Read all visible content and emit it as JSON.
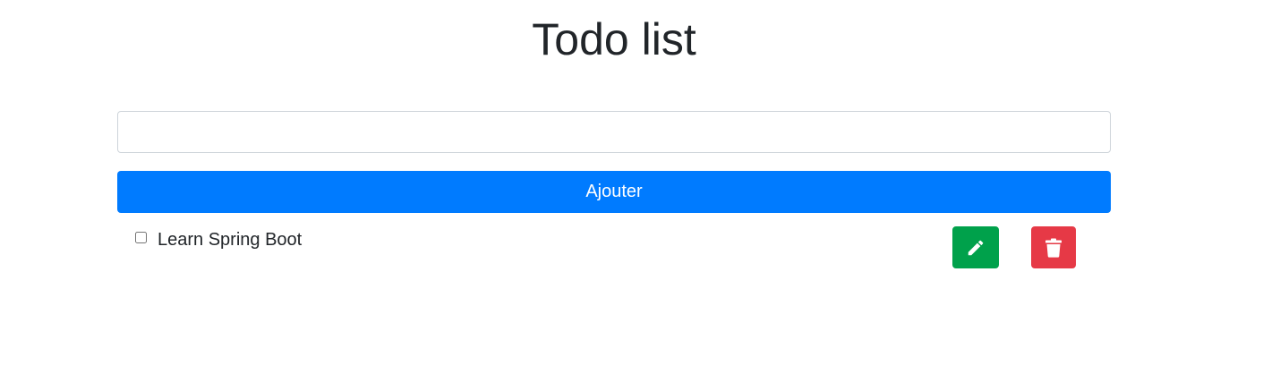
{
  "page": {
    "title": "Todo list"
  },
  "form": {
    "input_value": "",
    "input_placeholder": "",
    "add_button_label": "Ajouter"
  },
  "todos": [
    {
      "label": "Learn Spring Boot",
      "checked": false,
      "edit_icon": "pencil-icon",
      "delete_icon": "trash-icon"
    }
  ],
  "colors": {
    "primary": "#007bff",
    "edit": "#00a14b",
    "delete": "#e63946"
  }
}
